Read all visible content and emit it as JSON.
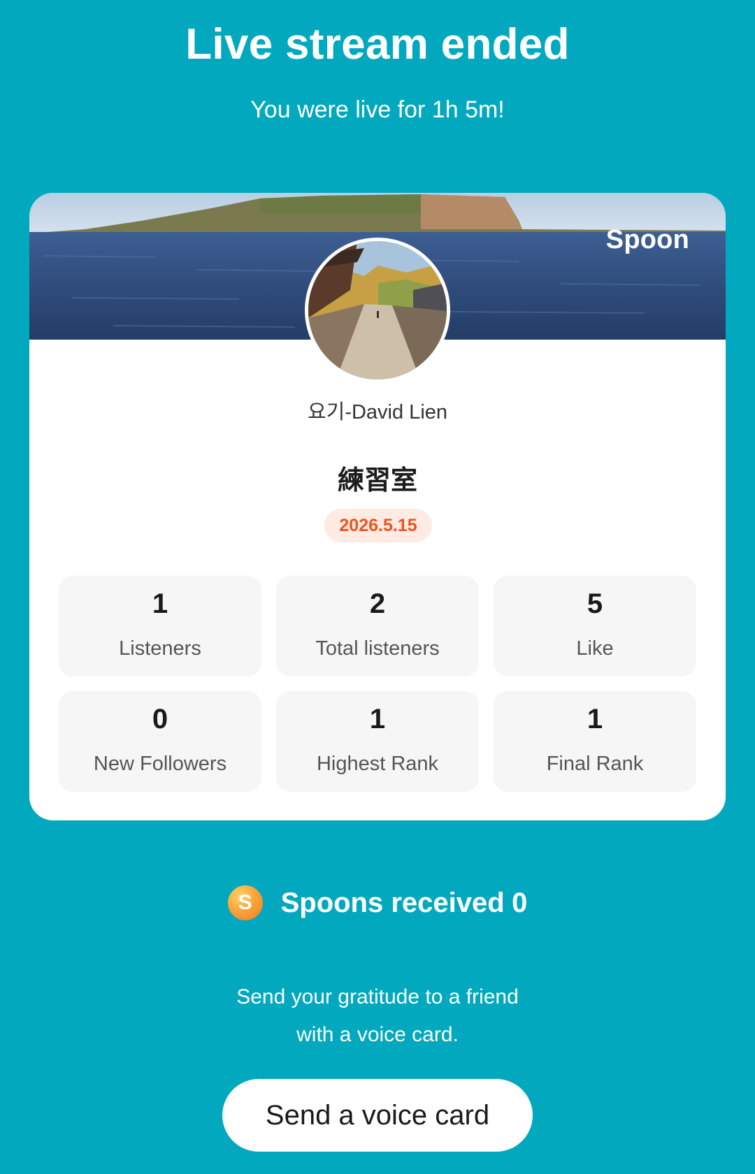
{
  "header": {
    "title": "Live stream ended",
    "subtitle": "You were live for 1h 5m!"
  },
  "card": {
    "brand": "Spoon",
    "username": "요기-David Lien",
    "room_title": "練習室",
    "date": "2026.5.15",
    "stats": [
      {
        "value": "1",
        "label": "Listeners"
      },
      {
        "value": "2",
        "label": "Total listeners"
      },
      {
        "value": "5",
        "label": "Like"
      },
      {
        "value": "0",
        "label": "New Followers"
      },
      {
        "value": "1",
        "label": "Highest Rank"
      },
      {
        "value": "1",
        "label": "Final Rank"
      }
    ]
  },
  "spoons": {
    "icon": "spoon-coin-icon",
    "coin_letter": "S",
    "label": "Spoons received",
    "count": "0"
  },
  "gratitude": {
    "line1": "Send your gratitude to a friend",
    "line2": "with a voice card."
  },
  "cta": {
    "label": "Send a voice card"
  },
  "colors": {
    "background": "#02A9BE",
    "card": "#FFFFFF",
    "date_badge_bg": "#FDEBE4",
    "date_badge_text": "#F0531C",
    "stat_tile": "#F6F6F6"
  }
}
